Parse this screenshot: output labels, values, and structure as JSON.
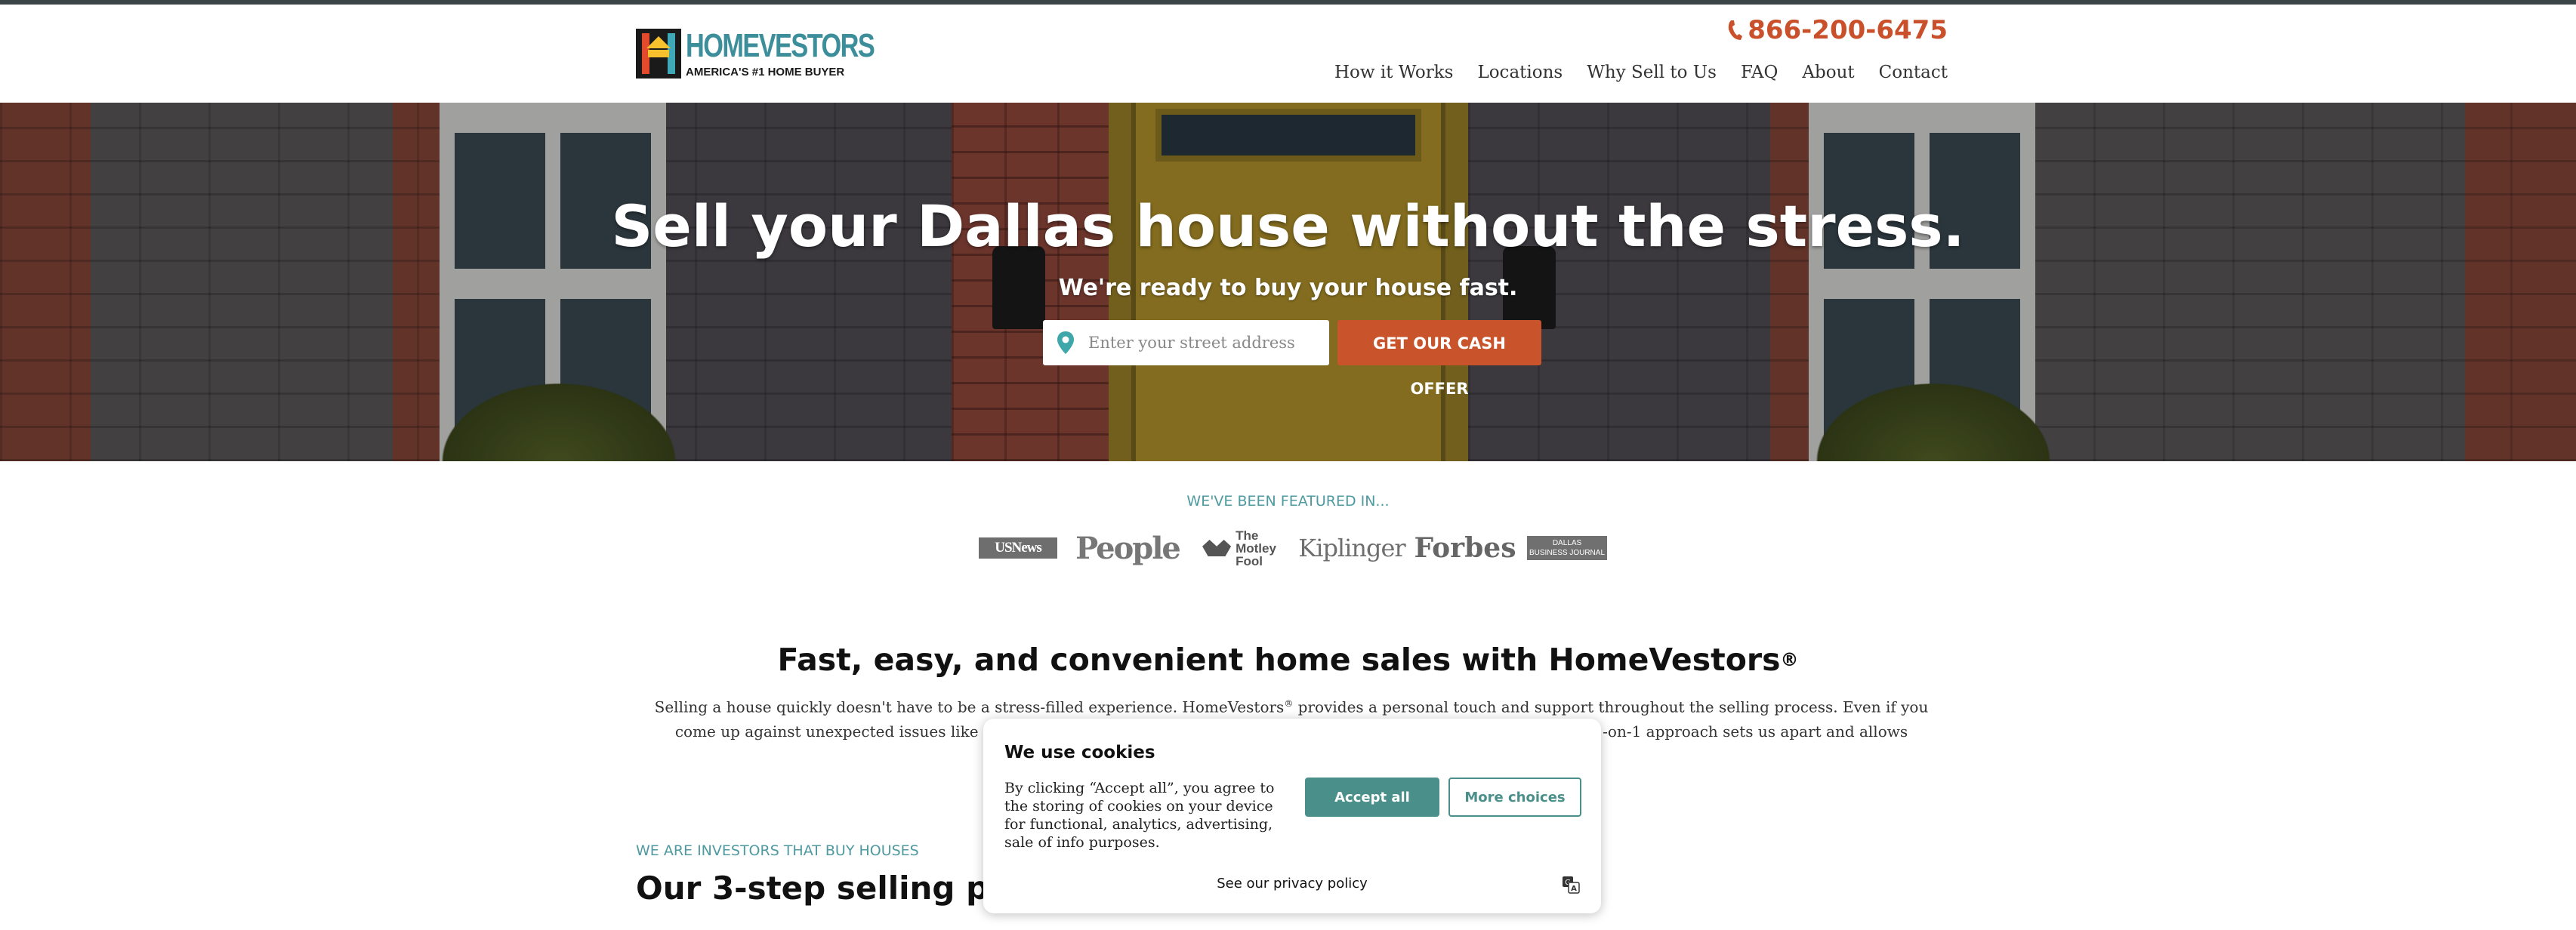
{
  "header": {
    "logo_name": "HOMEVESTORS",
    "logo_tagline": "AMERICA'S #1 HOME BUYER",
    "phone": "866-200-6475",
    "nav": [
      "How it Works",
      "Locations",
      "Why Sell to Us",
      "FAQ",
      "About",
      "Contact"
    ]
  },
  "hero": {
    "title": "Sell your Dallas house without the stress.",
    "subtitle": "We're ready to buy your house fast.",
    "address_placeholder": "Enter your street address",
    "cta_label": "GET OUR CASH OFFER"
  },
  "featured": {
    "label": "WE'VE BEEN FEATURED IN...",
    "logos": {
      "usnews": "USNews",
      "people": "People",
      "fool_1": "The",
      "fool_2": "Motley",
      "fool_3": "Fool",
      "kiplinger": "Kiplinger",
      "forbes": "Forbes",
      "dbj_1": "DALLAS",
      "dbj_2": "BUSINESS JOURNAL"
    }
  },
  "main": {
    "title": "Fast, easy, and convenient home sales with HomeVestors",
    "title_mark": "®",
    "copy_1": "Selling a house quickly doesn't have to be a stress-filled experience. HomeVestors",
    "copy_mark": "®",
    "copy_2": " provides a personal touch and support throughout the selling process. Even if you come up against unexpected issues like code violations or deferre",
    "copy_3": "ow our 1-on-1 approach sets us apart and allows",
    "steps_eyebrow": "WE ARE INVESTORS THAT BUY HOUSES",
    "steps_title": "Our 3-step selling proce"
  },
  "cookie": {
    "title": "We use cookies",
    "text": "By clicking “Accept all”, you agree to the storing of cookies on your device for functional, analytics, advertising, sale of info purposes.",
    "accept": "Accept all",
    "more": "More choices",
    "privacy": "See our privacy policy"
  },
  "colors": {
    "brand_teal": "#4a8f8a",
    "cta_orange": "#c9532b",
    "phone_orange": "#c9502a",
    "eyebrow_teal": "#4e9aa0"
  },
  "icons": {
    "phone": "phone-icon",
    "pin": "location-pin-icon",
    "translate": "translate-icon"
  }
}
